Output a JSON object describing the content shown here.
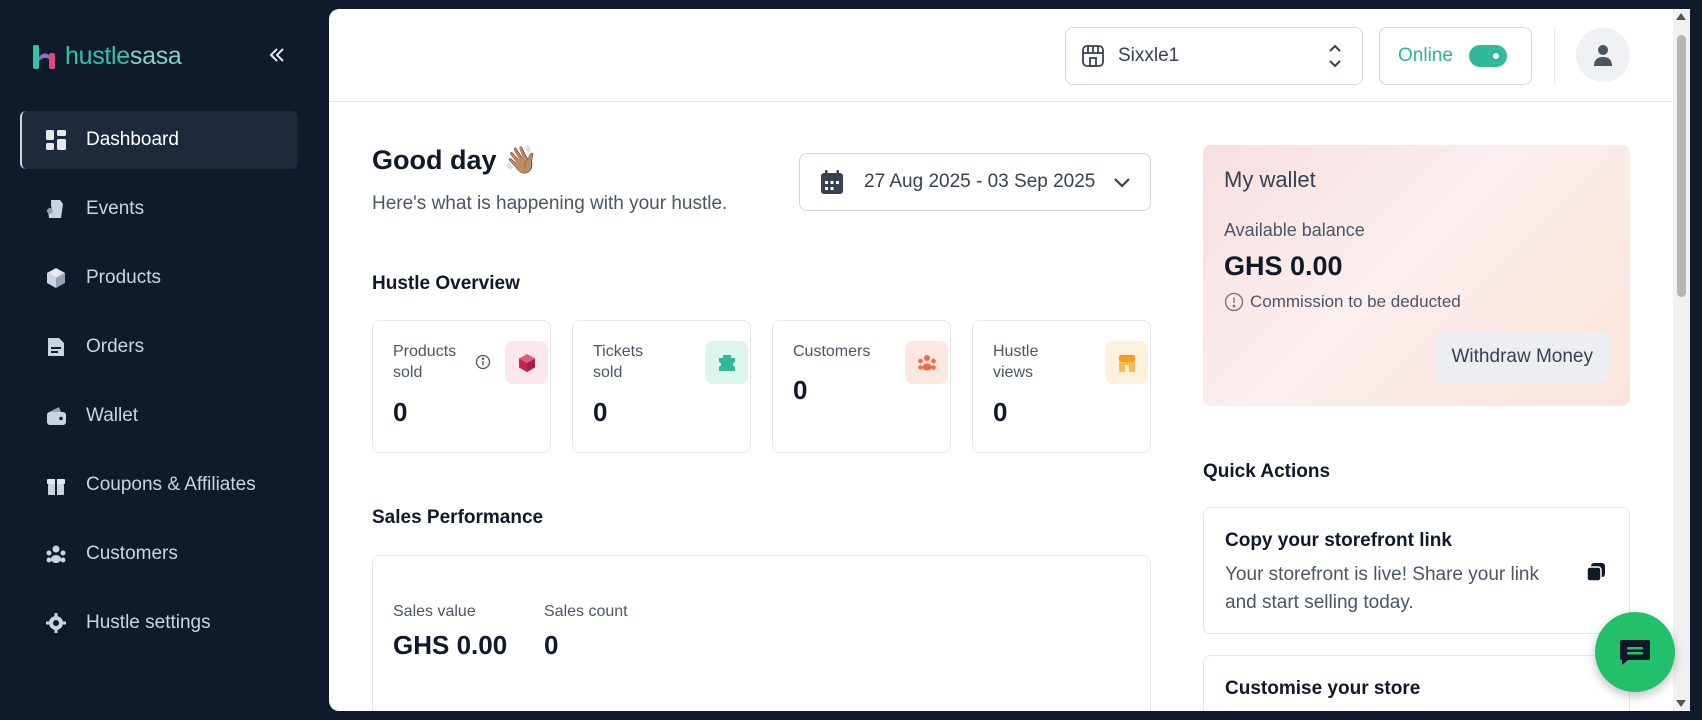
{
  "brand": {
    "part1": "hustle",
    "part2": "sasa"
  },
  "sidebar": {
    "items": [
      {
        "label": "Dashboard",
        "icon": "dashboard-icon",
        "active": true
      },
      {
        "label": "Events",
        "icon": "events-icon"
      },
      {
        "label": "Products",
        "icon": "box-icon"
      },
      {
        "label": "Orders",
        "icon": "orders-icon"
      },
      {
        "label": "Wallet",
        "icon": "wallet-icon"
      },
      {
        "label": "Coupons & Affiliates",
        "icon": "gift-icon"
      },
      {
        "label": "Customers",
        "icon": "customers-icon"
      },
      {
        "label": "Hustle settings",
        "icon": "gear-icon"
      }
    ]
  },
  "topbar": {
    "store_name": "Sixxle1",
    "status_label": "Online",
    "status_on": true
  },
  "main": {
    "greeting": "Good day 👋🏽",
    "subtitle": "Here's what is happening with your hustle.",
    "date_range": "27 Aug 2025 - 03 Sep 2025",
    "overview_title": "Hustle Overview",
    "stats": [
      {
        "label": "Products sold",
        "value": "0",
        "color": "#fce7ee",
        "icon_color": "#c0264f"
      },
      {
        "label": "Tickets sold",
        "value": "0",
        "color": "#dcf5ef",
        "icon_color": "#2fb899"
      },
      {
        "label": "Customers",
        "value": "0",
        "color": "#fde8e1",
        "icon_color": "#f06a43"
      },
      {
        "label": "Hustle views",
        "value": "0",
        "color": "#fdf0dd",
        "icon_color": "#f0a020"
      }
    ],
    "sales_title": "Sales Performance",
    "sales_value_label": "Sales value",
    "sales_value": "GHS 0.00",
    "sales_count_label": "Sales count",
    "sales_count": "0"
  },
  "wallet": {
    "title": "My wallet",
    "available_label": "Available balance",
    "balance": "GHS 0.00",
    "commission_note": "Commission to be deducted",
    "withdraw_label": "Withdraw Money"
  },
  "quick_actions": {
    "title": "Quick Actions",
    "items": [
      {
        "title": "Copy your storefront link",
        "desc": "Your storefront is live! Share your link and start selling today."
      },
      {
        "title": "Customise your store",
        "desc": ""
      }
    ]
  }
}
